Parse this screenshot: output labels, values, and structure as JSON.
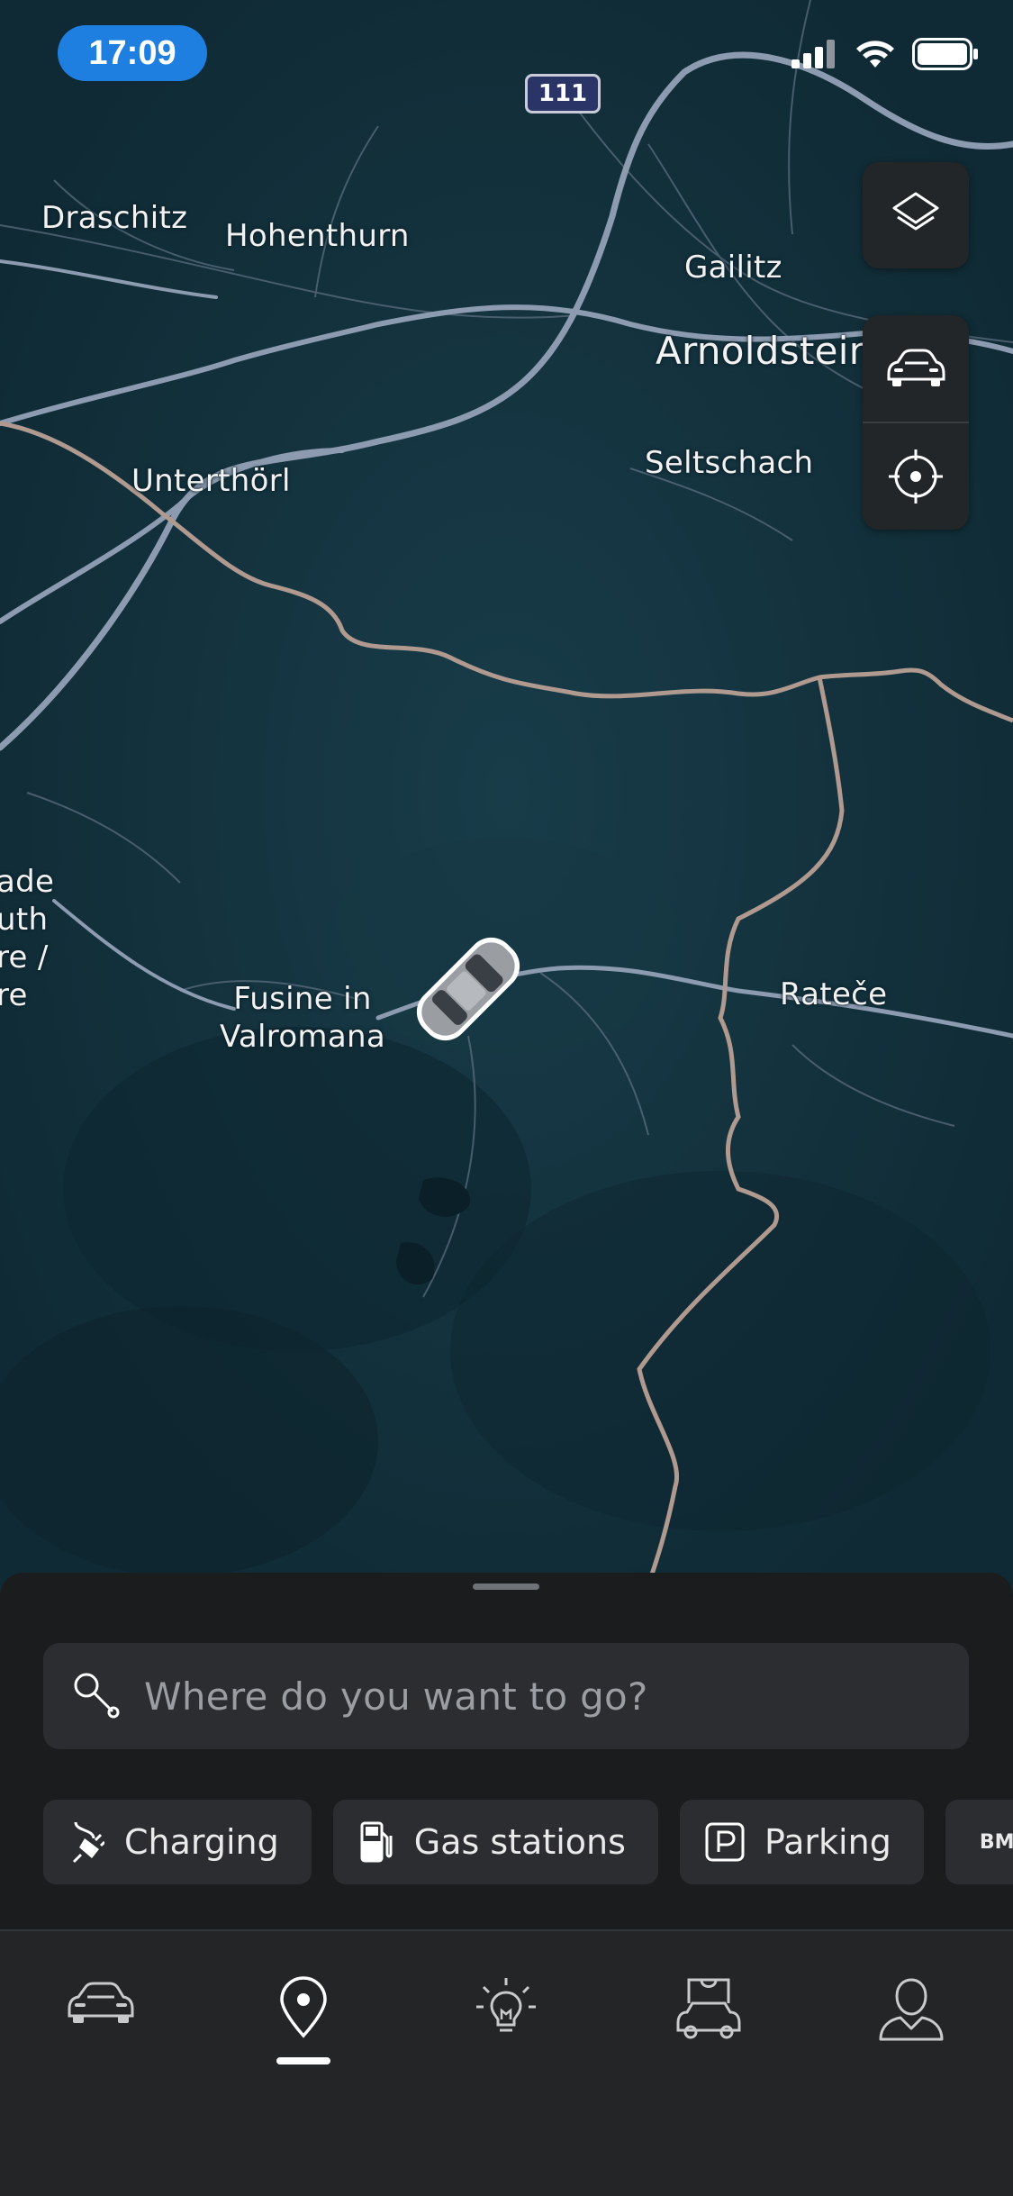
{
  "status_bar": {
    "time": "17:09",
    "icons": [
      "cellular-signal-icon",
      "wifi-icon",
      "battery-icon"
    ]
  },
  "map": {
    "road_shield": "111",
    "places": [
      {
        "name": "Draschitz"
      },
      {
        "name": "Hohenthurn"
      },
      {
        "name": "Gailitz"
      },
      {
        "name": "Arnoldstein"
      },
      {
        "name": "Seltschach"
      },
      {
        "name": "Unterthörl"
      },
      {
        "name": "Fusine in\nValromana"
      },
      {
        "name": "Rateče"
      },
      {
        "name": "ade\nuth\nre /\nre"
      }
    ],
    "colors": {
      "background": "#12303b",
      "roads": "#8d9bb0",
      "border": "#b09a90"
    }
  },
  "map_controls": {
    "icons": [
      "layers-icon",
      "vehicle-location-icon",
      "my-location-icon"
    ]
  },
  "sheet": {
    "search_placeholder": "Where do you want to go?",
    "chips": [
      {
        "label": "Charging",
        "icon": "charging-plug-icon"
      },
      {
        "label": "Gas stations",
        "icon": "fuel-pump-icon"
      },
      {
        "label": "Parking",
        "icon": "parking-icon"
      },
      {
        "label": "BM",
        "icon": "bmw-icon"
      }
    ]
  },
  "tab_bar": {
    "tabs": [
      {
        "name": "car",
        "icon": "car-icon"
      },
      {
        "name": "map",
        "icon": "map-pin-icon",
        "selected": true
      },
      {
        "name": "ideas",
        "icon": "lightbulb-icon"
      },
      {
        "name": "shop",
        "icon": "shop-car-icon"
      },
      {
        "name": "profile",
        "icon": "profile-icon"
      }
    ]
  }
}
